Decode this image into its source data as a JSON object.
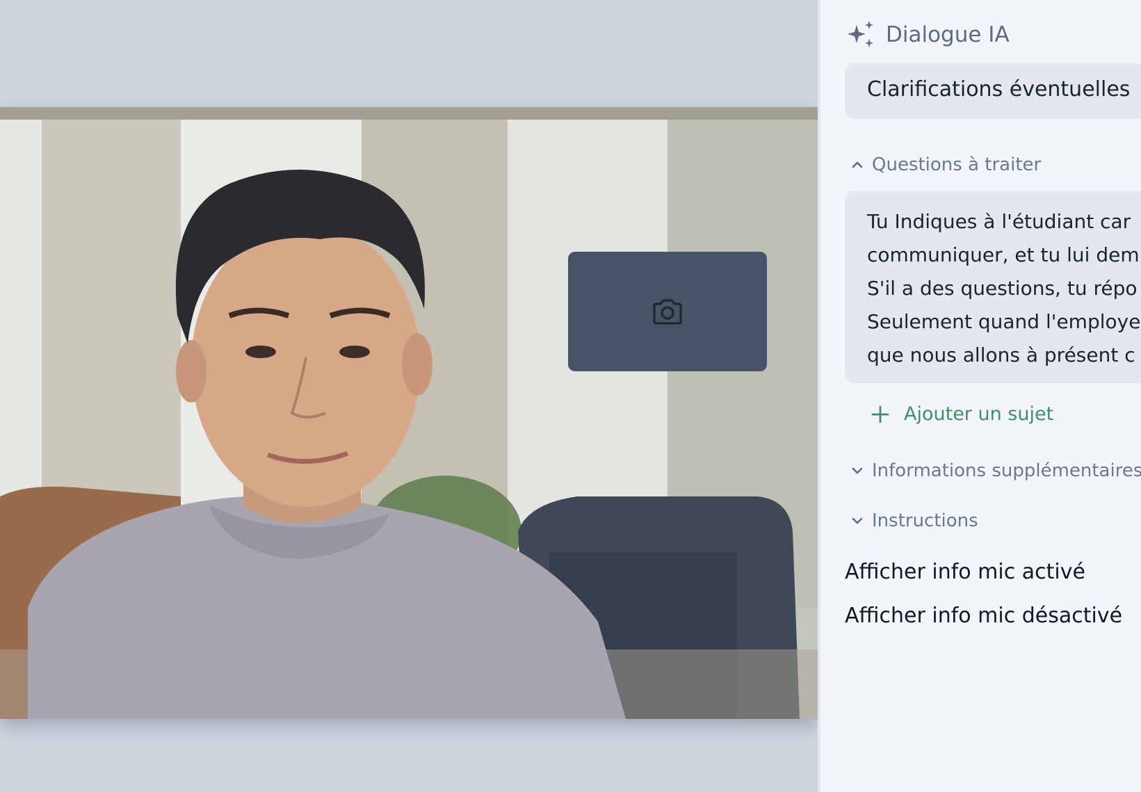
{
  "panel": {
    "title": "Dialogue IA",
    "topic_pill": "Clarifications éventuelles",
    "sections": {
      "questions": "Questions à traiter",
      "extra_info": "Informations supplémentaires",
      "instructions": "Instructions"
    },
    "questions_text": [
      "Tu Indiques à l'étudiant car",
      "communiquer, et tu lui dem",
      "S'il a des questions, tu répo",
      "Seulement quand l'employe",
      "que nous allons à présent c"
    ],
    "add_topic": "Ajouter un sujet",
    "mic_on_toggle": "Afficher info mic activé",
    "mic_off_toggle": "Afficher info mic désactivé"
  },
  "icons": {
    "title": "sparkles-icon",
    "pip": "camera-icon",
    "expanded": "chevron-up-icon",
    "collapsed": "chevron-down-icon",
    "add": "plus-icon"
  },
  "colors": {
    "accent_green": "#3f8f6e",
    "panel_bg": "#f2f5f9",
    "pill_bg": "#e4e8ee",
    "pip_bg": "#475467"
  }
}
